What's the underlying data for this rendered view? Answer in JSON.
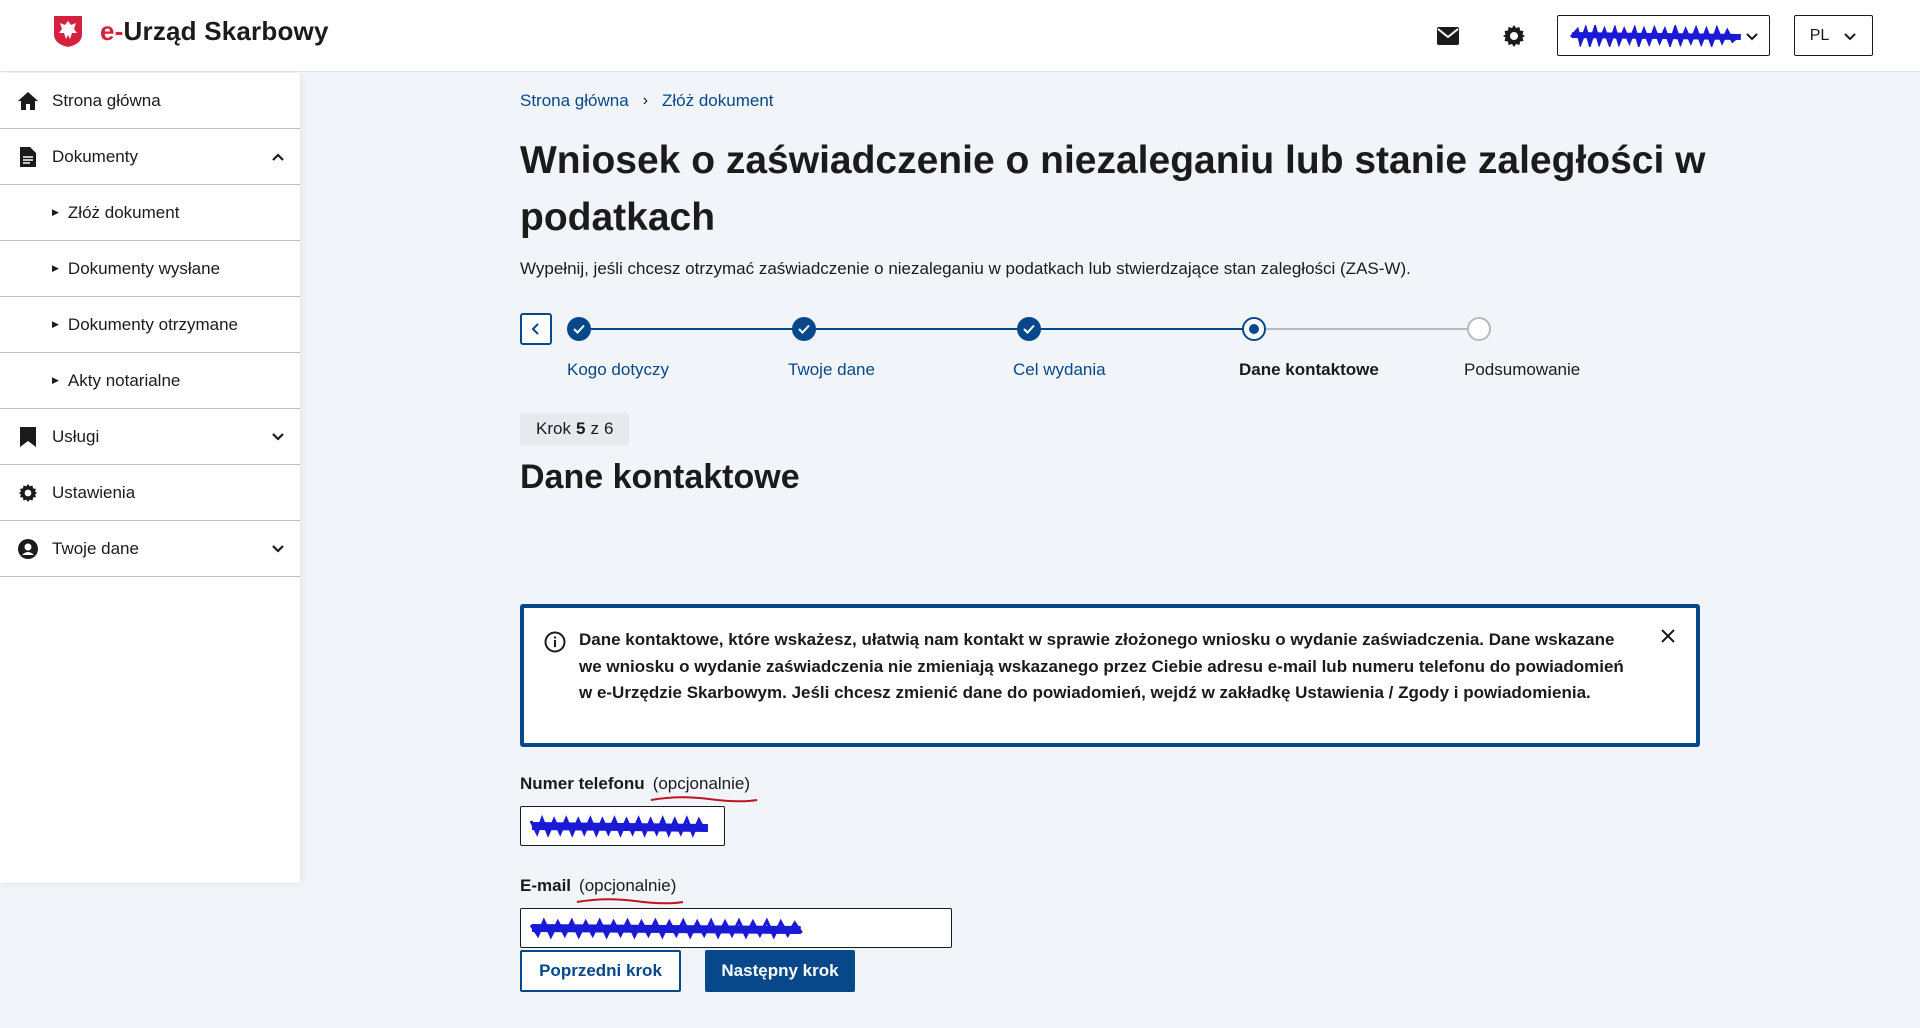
{
  "header": {
    "app_title_e": "e-",
    "app_title_rest": "Urząd Skarbowy",
    "language": "PL"
  },
  "sidebar": {
    "items": [
      {
        "label": "Strona główna",
        "icon": "home-icon"
      },
      {
        "label": "Dokumenty",
        "icon": "document-icon",
        "expanded": true
      },
      {
        "label": "Złóż dokument",
        "sub": true
      },
      {
        "label": "Dokumenty wysłane",
        "sub": true
      },
      {
        "label": "Dokumenty otrzymane",
        "sub": true
      },
      {
        "label": "Akty notarialne",
        "sub": true
      },
      {
        "label": "Usługi",
        "icon": "bookmark-icon",
        "expanded": false
      },
      {
        "label": "Ustawienia",
        "icon": "gear-icon"
      },
      {
        "label": "Twoje dane",
        "icon": "user-icon",
        "expanded": false
      }
    ]
  },
  "breadcrumb": {
    "home": "Strona główna",
    "current": "Złóż dokument"
  },
  "page": {
    "title": "Wniosek o zaświadczenie o niezaleganiu lub stanie zaległości w podatkach",
    "description": "Wypełnij, jeśli chcesz otrzymać zaświadczenie o niezaleganiu w podatkach lub stwierdzające stan zaległości (ZAS-W)."
  },
  "stepper": {
    "steps": [
      {
        "label": "Kogo dotyczy",
        "state": "done"
      },
      {
        "label": "Twoje dane",
        "state": "done"
      },
      {
        "label": "Cel wydania",
        "state": "done"
      },
      {
        "label": "Dane kontaktowe",
        "state": "current"
      },
      {
        "label": "Podsumowanie",
        "state": "todo"
      }
    ],
    "badge_prefix": "Krok",
    "badge_current": "5",
    "badge_sep": "z",
    "badge_total": "6"
  },
  "section": {
    "title": "Dane kontaktowe",
    "info": "Dane kontaktowe, które wskażesz, ułatwią nam kontakt w sprawie złożonego wniosku o wydanie zaświadczenia. Dane wskazane we wniosku o wydanie zaświadczenia nie zmieniają wskazanego przez Ciebie adresu e-mail lub numeru telefonu do powiadomień w e-Urzędzie Skarbowym. Jeśli chcesz zmienić dane do powiadomień, wejdź w zakładkę Ustawienia / Zgody i powiadomienia."
  },
  "form": {
    "phone_label": "Numer telefonu",
    "phone_optional": "(opcjonalnie)",
    "email_label": "E-mail",
    "email_optional": "(opcjonalnie)"
  },
  "buttons": {
    "prev": "Poprzedni krok",
    "next": "Następny krok"
  },
  "colors": {
    "primary": "#064889",
    "brand_red": "#d4213d",
    "redaction": "#1a1ad6",
    "annotation": "#c0141e"
  }
}
